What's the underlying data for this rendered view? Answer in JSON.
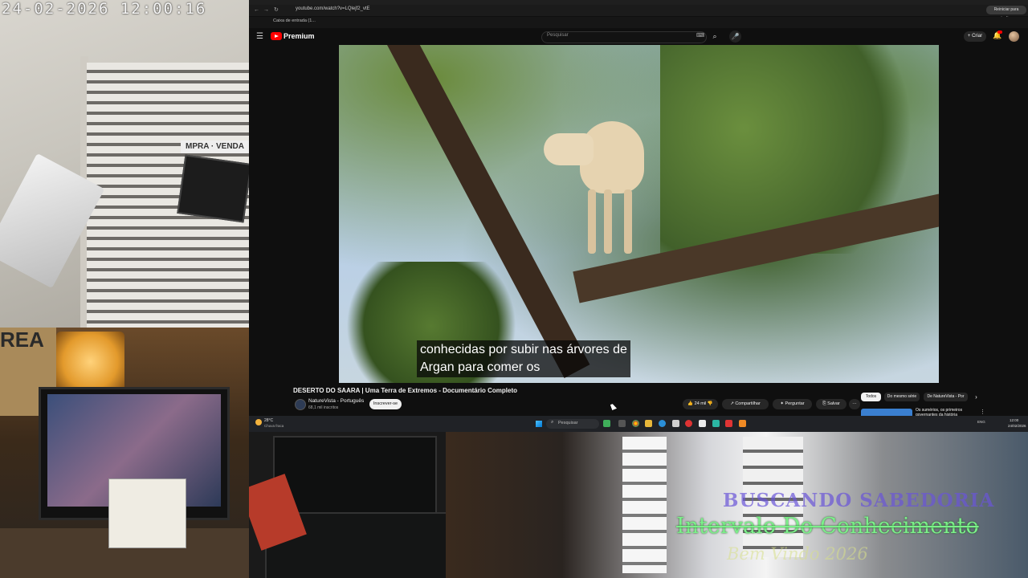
{
  "camera": {
    "timestamp": "24-02-2026 12:00:16",
    "graffiti": "REA"
  },
  "browser": {
    "url": "youtube.com/watch?v=LQlejf2_vtE",
    "restart_label": "Reiniciar para atualizar",
    "bookmark": "Caixa de entrada (1...",
    "nav": {
      "back": "←",
      "forward": "→",
      "reload": "↻"
    }
  },
  "youtube": {
    "brand": "Premium",
    "search_placeholder": "Pesquisar",
    "create_label": "+ Criar",
    "icons": {
      "menu": "☰",
      "search": "⌕",
      "mic": "🎤",
      "keyboard": "⌨",
      "bell": "🔔"
    }
  },
  "video": {
    "subtitle_line1": "conhecidas por subir nas árvores de",
    "subtitle_line2": "Argan para comer os",
    "title": "DESERTO DO SAARA | Uma Terra de Extremos - Documentário Completo",
    "channel": "NatureVista - Português",
    "subscribers": "68,1 mil inscritos",
    "subscribe_label": "Inscrever-se",
    "likes": "24 mil",
    "share_label": "Compartilhar",
    "ask_label": "Perguntar",
    "save_label": "Salvar",
    "more_label": "···"
  },
  "recommendations": {
    "chips": [
      "Todos",
      "Do mesmo série",
      "De NatureVista - Por"
    ],
    "next_arrow": "›",
    "first_title": "Os sumérios, os primeiros governantes da história",
    "more": "⋮"
  },
  "taskbar": {
    "weather_temp": "28°C",
    "weather_desc": "Chuva fraca",
    "search_label": "Pesquisar",
    "tray": "ENG",
    "time": "12:00",
    "date": "24/02/2026"
  },
  "overlay": {
    "line1": "BUSCANDO SABEDORIA",
    "line2": "Intervalo Do Conhecimento",
    "line3": "Bem Vindo 2026"
  }
}
